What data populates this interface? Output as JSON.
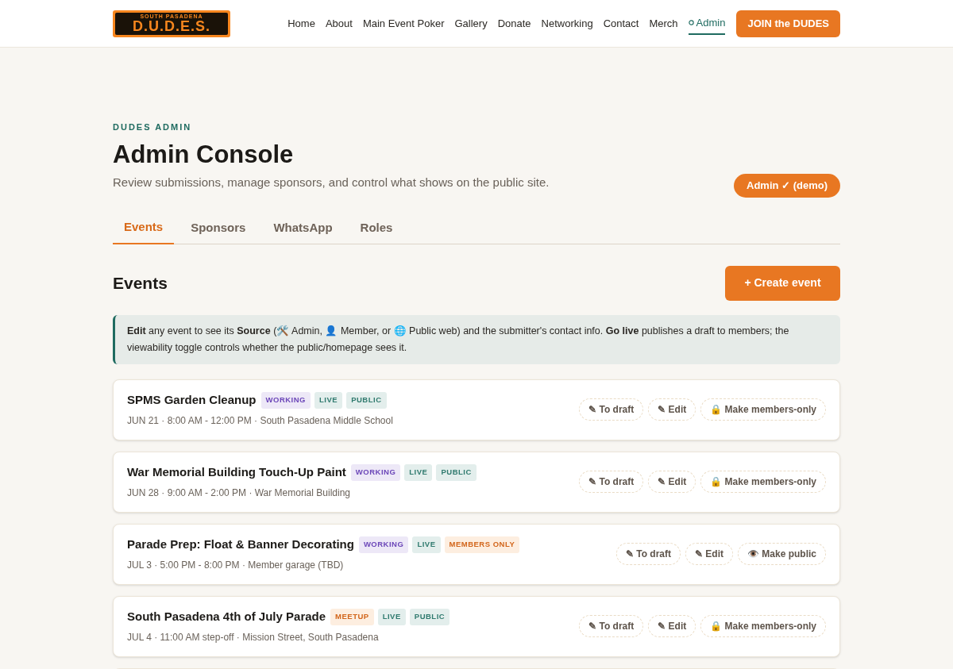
{
  "logo": {
    "top": "SOUTH PASADENA",
    "main": "D.U.D.E.S."
  },
  "nav": [
    {
      "label": "Home",
      "selected": false
    },
    {
      "label": "About",
      "selected": false
    },
    {
      "label": "Main Event Poker",
      "selected": false
    },
    {
      "label": "Gallery",
      "selected": false
    },
    {
      "label": "Donate",
      "selected": false
    },
    {
      "label": "Networking",
      "selected": false
    },
    {
      "label": "Contact",
      "selected": false
    },
    {
      "label": "Merch",
      "selected": false
    },
    {
      "label": "Admin",
      "selected": true
    }
  ],
  "join_button": "JOIN the DUDES",
  "eyebrow": "DUDES ADMIN",
  "title": "Admin Console",
  "subtitle": "Review submissions, manage sponsors, and control what shows on the public site.",
  "admin_badge": "Admin ✓ (demo)",
  "tabs": [
    {
      "label": "Events",
      "selected": true
    },
    {
      "label": "Sponsors",
      "selected": false
    },
    {
      "label": "WhatsApp",
      "selected": false
    },
    {
      "label": "Roles",
      "selected": false
    }
  ],
  "section_title": "Events",
  "create_button": "+ Create event",
  "info": "**Edit** any event to see its **Source** (🛠️ Admin, 👤 Member, or 🌐 Public web) and the submitter's contact info. **Go live** publishes a draft to members; the viewability toggle controls whether the public/homepage sees it.",
  "events": [
    {
      "title": "SPMS Garden Cleanup",
      "tags": [
        {
          "label": "WORKING",
          "kind": "working"
        },
        {
          "label": "LIVE",
          "kind": "live"
        },
        {
          "label": "PUBLIC",
          "kind": "public"
        }
      ],
      "meta": "JUN 21 · 8:00 AM - 12:00 PM · South Pasadena Middle School",
      "actions": [
        "✎ To draft",
        "✎ Edit",
        "🔒 Make members-only"
      ]
    },
    {
      "title": "War Memorial Building Touch-Up Paint",
      "tags": [
        {
          "label": "WORKING",
          "kind": "working"
        },
        {
          "label": "LIVE",
          "kind": "live"
        },
        {
          "label": "PUBLIC",
          "kind": "public"
        }
      ],
      "meta": "JUN 28 · 9:00 AM - 2:00 PM · War Memorial Building",
      "actions": [
        "✎ To draft",
        "✎ Edit",
        "🔒 Make members-only"
      ]
    },
    {
      "title": "Parade Prep: Float & Banner Decorating",
      "tags": [
        {
          "label": "WORKING",
          "kind": "working"
        },
        {
          "label": "LIVE",
          "kind": "live"
        },
        {
          "label": "MEMBERS ONLY",
          "kind": "members"
        }
      ],
      "meta": "JUL 3 · 5:00 PM - 8:00 PM · Member garage (TBD)",
      "actions": [
        "✎ To draft",
        "✎ Edit",
        "👁️ Make public"
      ]
    },
    {
      "title": "South Pasadena 4th of July Parade",
      "tags": [
        {
          "label": "MEETUP",
          "kind": "meetup"
        },
        {
          "label": "LIVE",
          "kind": "live"
        },
        {
          "label": "PUBLIC",
          "kind": "public"
        }
      ],
      "meta": "JUL 4 · 11:00 AM step-off · Mission Street, South Pasadena",
      "actions": [
        "✎ To draft",
        "✎ Edit",
        "🔒 Make members-only"
      ]
    }
  ]
}
